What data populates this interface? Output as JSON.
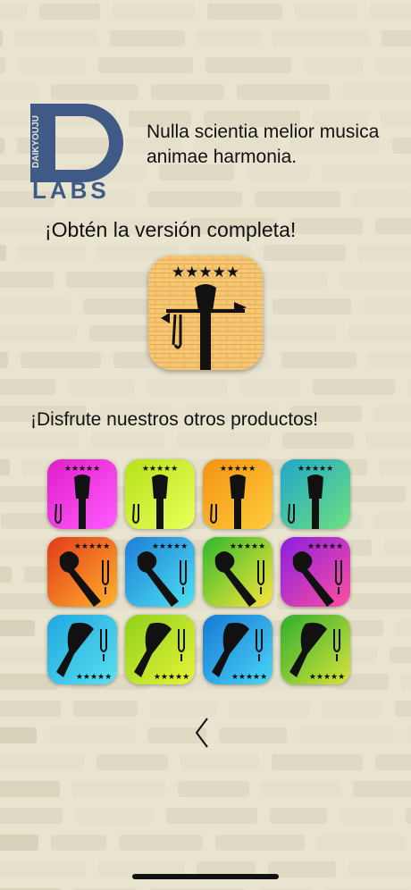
{
  "branding": {
    "logo_vertical_text": "DAIKYOUJU",
    "logo_text": "LABS",
    "logo_color": "#3f5a86",
    "tagline": "Nulla scientia melior musica animae harmonia."
  },
  "promo": {
    "headline": "¡Obtén la versión completa!",
    "app_icon": "guitar-headstock-icon",
    "stars": "★★★★★"
  },
  "others": {
    "headline": "¡Disfrute nuestros otros productos!",
    "apps": [
      {
        "name": "bass-tuner-icon",
        "colors": [
          "#e01ec8",
          "#ff5cff"
        ],
        "stars": "★★★★★"
      },
      {
        "name": "ukulele-tuner-icon",
        "colors": [
          "#b7e21a",
          "#e9ff5b"
        ],
        "stars": "★★★★★"
      },
      {
        "name": "twelve-string-tuner-icon",
        "colors": [
          "#f29214",
          "#ffcc3a"
        ],
        "stars": "★★★★★"
      },
      {
        "name": "mandolin-tuner-icon",
        "colors": [
          "#1fa7c9",
          "#6ee07f"
        ],
        "stars": "★★★★★"
      },
      {
        "name": "violin-tuner-orange-icon",
        "colors": [
          "#e23a1b",
          "#ffb12b"
        ],
        "stars": "★★★★★"
      },
      {
        "name": "violin-tuner-blue-icon",
        "colors": [
          "#1e7dd8",
          "#4de2f0"
        ],
        "stars": "★★★★★"
      },
      {
        "name": "violin-tuner-green-icon",
        "colors": [
          "#2dba2c",
          "#ffe53a"
        ],
        "stars": "★★★★★"
      },
      {
        "name": "violin-tuner-purple-icon",
        "colors": [
          "#8a1fe0",
          "#ff4fa0"
        ],
        "stars": "★★★★★"
      },
      {
        "name": "guitar-tuner-cyan-icon",
        "colors": [
          "#1ea7e0",
          "#5be0f0"
        ],
        "stars": "★★★★★"
      },
      {
        "name": "guitar-tuner-lime-icon",
        "colors": [
          "#90d11a",
          "#e6f33b"
        ],
        "stars": "★★★★★"
      },
      {
        "name": "electric-guitar-blue-icon",
        "colors": [
          "#1778d6",
          "#49d6f5"
        ],
        "stars": "★★★★★"
      },
      {
        "name": "electric-guitar-green-icon",
        "colors": [
          "#2fae2e",
          "#d9e33a"
        ],
        "stars": "★★★★★"
      }
    ]
  },
  "nav": {
    "back_icon": "chevron-left-icon"
  }
}
